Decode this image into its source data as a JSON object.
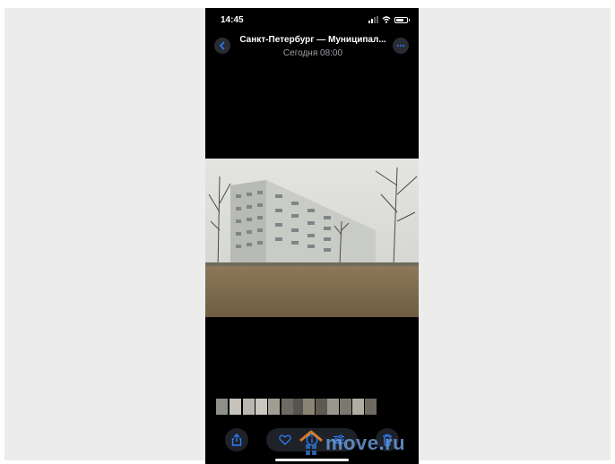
{
  "status_bar": {
    "time": "14:45"
  },
  "header": {
    "title": "Санкт-Петербург — Муниципал...",
    "subtitle": "Сегодня  08:00"
  },
  "icons": {
    "back": "chevron-left-icon",
    "more": "ellipsis-icon",
    "share": "share-icon",
    "favorite": "heart-icon",
    "info": "info-icon",
    "adjust": "sliders-icon",
    "delete": "trash-icon"
  },
  "colors": {
    "accent": "#2f7cf6",
    "button_bg": "#1e2128",
    "watermark": "#6a9bd8"
  },
  "watermark": {
    "text": "move.ru"
  },
  "thumbnails_count": 13
}
